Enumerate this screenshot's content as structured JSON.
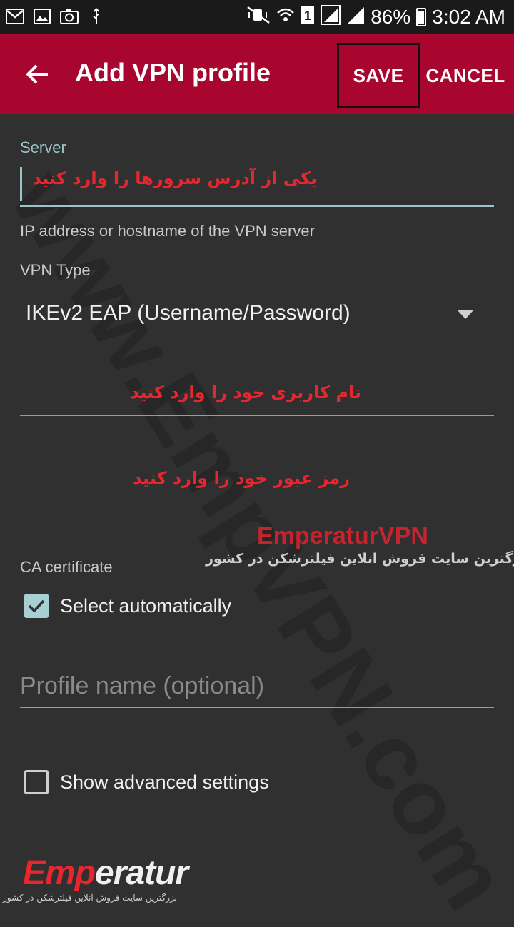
{
  "status_bar": {
    "battery": "86%",
    "time": "3:02 AM",
    "icons": [
      "gmail-icon",
      "gallery-icon",
      "camera-icon",
      "usb-icon",
      "mute-icon",
      "wifi-icon",
      "sim1-icon",
      "signal-icon",
      "signal2-icon",
      "battery-icon"
    ]
  },
  "app_bar": {
    "title": "Add VPN profile",
    "save_label": "SAVE",
    "cancel_label": "CANCEL",
    "color": "#a8062e"
  },
  "watermark": "www.EmpVPN.com",
  "form": {
    "server_label": "Server",
    "server_hint_fa": "یکی از آدرس سرورها را وارد کنید",
    "server_helper": "IP address or hostname of the VPN server",
    "vpn_type_label": "VPN Type",
    "vpn_type_value": "IKEv2 EAP (Username/Password)",
    "username_hint_fa": "نام کاربری خود را وارد کنید",
    "password_hint_fa": "رمز عبور خود را وارد کنید",
    "ca_label": "CA certificate",
    "select_auto_label": "Select automatically",
    "select_auto_checked": true,
    "profile_name_placeholder": "Profile name (optional)",
    "advanced_label": "Show advanced settings",
    "advanced_checked": false
  },
  "promo": {
    "title": "EmperaturVPN",
    "subtitle_fa": "بررگترین سایت فروش انلاین فیلترشکن در کشور"
  },
  "logo": {
    "part1": "Emp",
    "part2": "eratur",
    "subtitle_fa": "بزرگترین سایت فروش آنلاین فیلترشکن در کشور"
  }
}
